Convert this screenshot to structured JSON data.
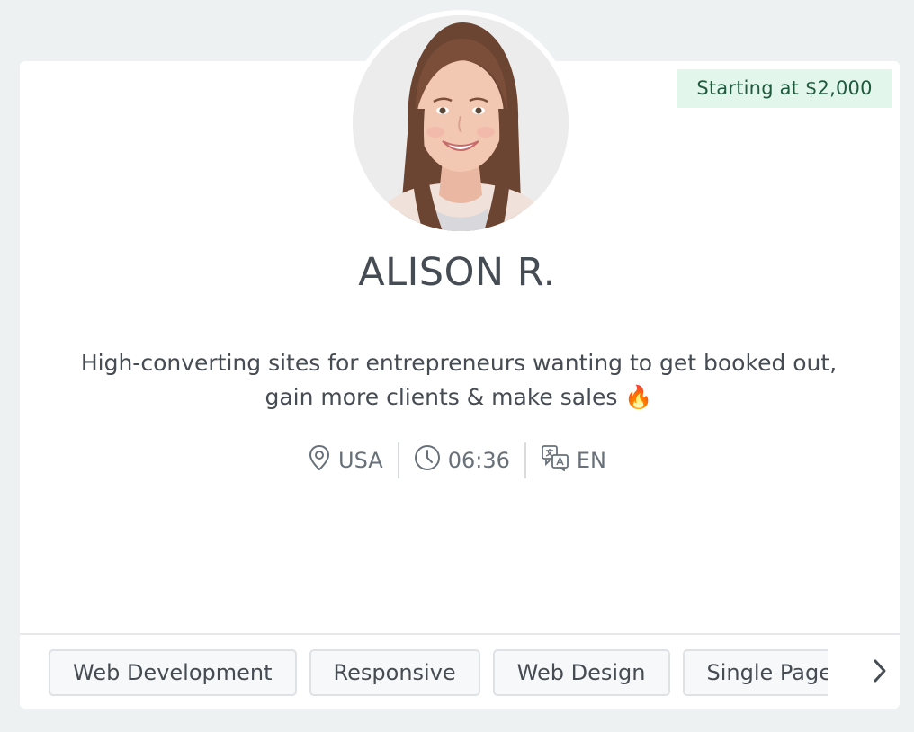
{
  "profile": {
    "name": "ALISON R.",
    "price_badge": "Starting at $2,000",
    "bio_line1": "High-converting sites for entrepreneurs wanting to get booked out,",
    "bio_line2": "gain more clients & make sales 🔥",
    "location": "USA",
    "local_time": "06:36",
    "language": "EN"
  },
  "tags": [
    "Web Development",
    "Responsive",
    "Web Design",
    "Single Page"
  ],
  "icons": {
    "location": "map-pin-icon",
    "time": "clock-icon",
    "language": "translate-icon",
    "next": "chevron-right-icon"
  },
  "colors": {
    "badge_bg": "#e3f6ec",
    "badge_text": "#1f5a3d",
    "text_primary": "#464c53",
    "text_secondary": "#68717a"
  }
}
